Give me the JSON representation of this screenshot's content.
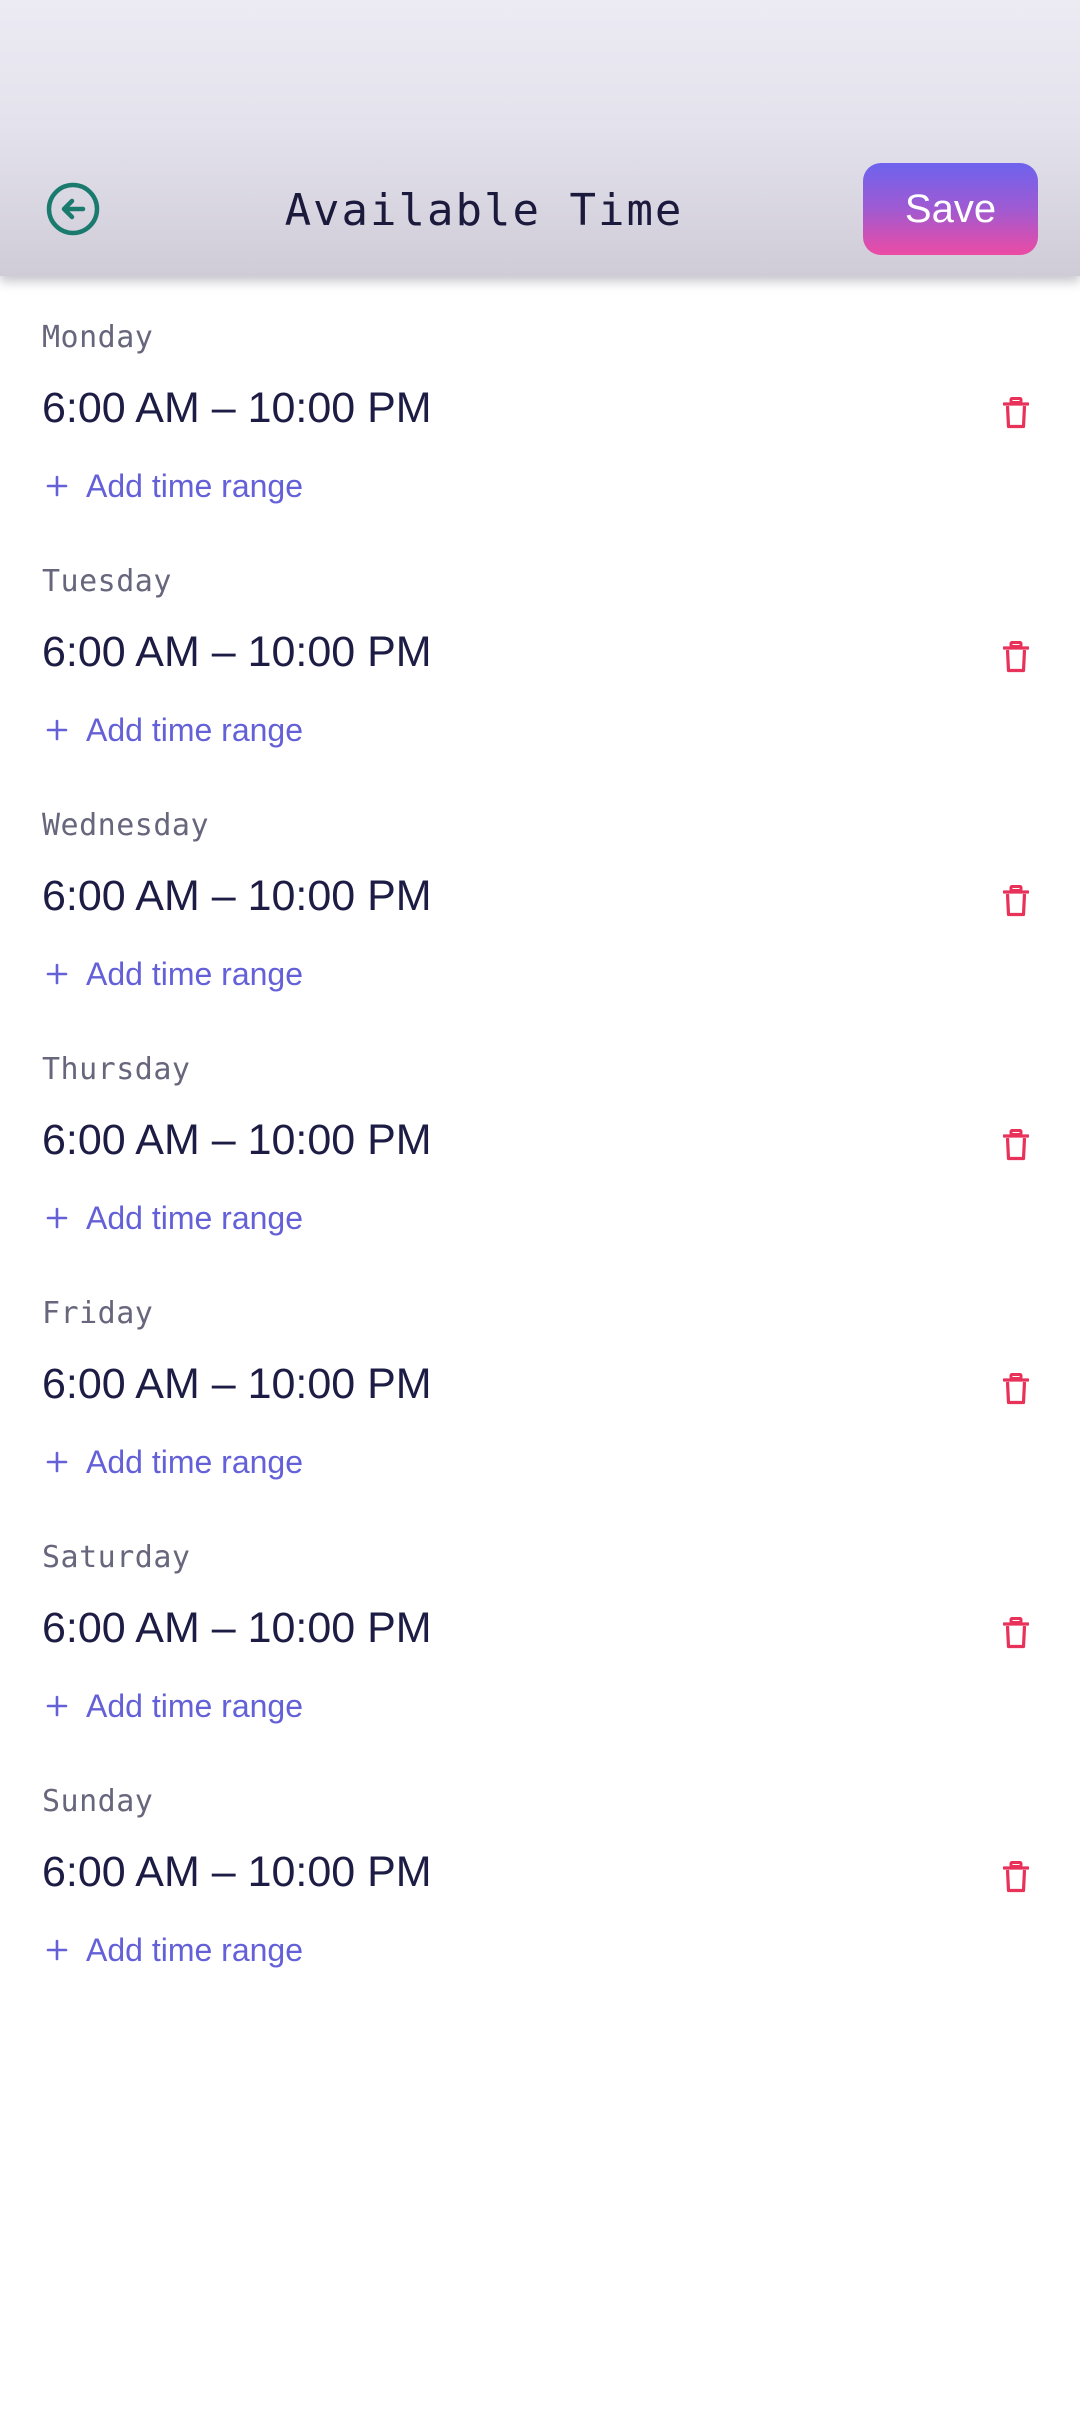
{
  "header": {
    "title": "Available Time",
    "save_label": "Save",
    "back_icon": "arrow-left-circle-icon"
  },
  "colors": {
    "accent": "#6360d8",
    "delete": "#e8325a",
    "back_icon": "#1a7a6e",
    "save_gradient_start": "#6d63ee",
    "save_gradient_end": "#ec4ba4"
  },
  "days": [
    {
      "label": "Monday",
      "time_range": "6:00 AM – 10:00 PM",
      "add_label": "Add time range"
    },
    {
      "label": "Tuesday",
      "time_range": "6:00 AM – 10:00 PM",
      "add_label": "Add time range"
    },
    {
      "label": "Wednesday",
      "time_range": "6:00 AM – 10:00 PM",
      "add_label": "Add time range"
    },
    {
      "label": "Thursday",
      "time_range": "6:00 AM – 10:00 PM",
      "add_label": "Add time range"
    },
    {
      "label": "Friday",
      "time_range": "6:00 AM – 10:00 PM",
      "add_label": "Add time range"
    },
    {
      "label": "Saturday",
      "time_range": "6:00 AM – 10:00 PM",
      "add_label": "Add time range"
    },
    {
      "label": "Sunday",
      "time_range": "6:00 AM – 10:00 PM",
      "add_label": "Add time range"
    }
  ]
}
